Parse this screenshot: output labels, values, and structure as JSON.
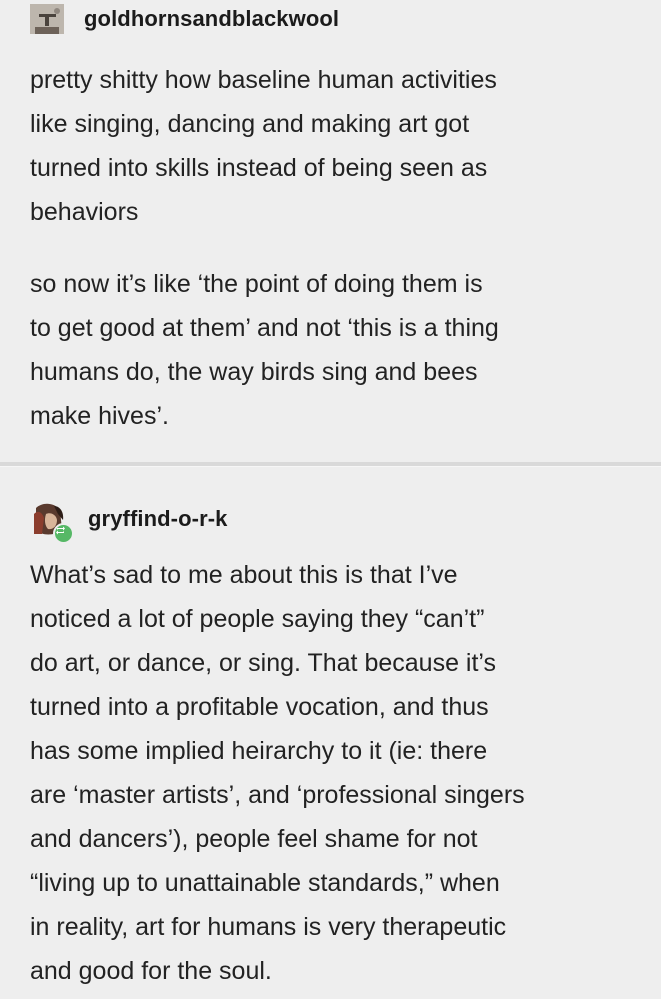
{
  "posts": [
    {
      "username": "goldhornsandblackwool",
      "avatar_icon": "user-avatar-icon",
      "paragraphs": [
        [
          "pretty shitty how baseline human activities",
          "like singing, dancing and making art got",
          "turned into skills  instead of being seen as",
          "behaviors"
        ],
        [
          "so now it’s like ‘the point of doing them is",
          "to get good at them’ and not ‘this is a thing",
          "humans do, the way birds sing and bees",
          "make hives’."
        ]
      ]
    },
    {
      "username": "gryffind-o-r-k",
      "avatar_icon": "user-avatar-icon",
      "badge_icon": "reblog-icon",
      "badge_color": "#56b866",
      "paragraphs": [
        [
          "What’s sad to me about this is that I’ve",
          "noticed a lot of people saying they “can’t”",
          "do art, or dance, or sing. That because it’s",
          "turned into a profitable vocation, and thus",
          "has some implied heirarchy to it (ie: there",
          "are ‘master artists’, and ‘professional singers",
          "and dancers’), people feel shame for not",
          "“living up to unattainable standards,” when",
          "in reality, art for humans is very therapeutic",
          "and good for the soul."
        ]
      ]
    }
  ]
}
